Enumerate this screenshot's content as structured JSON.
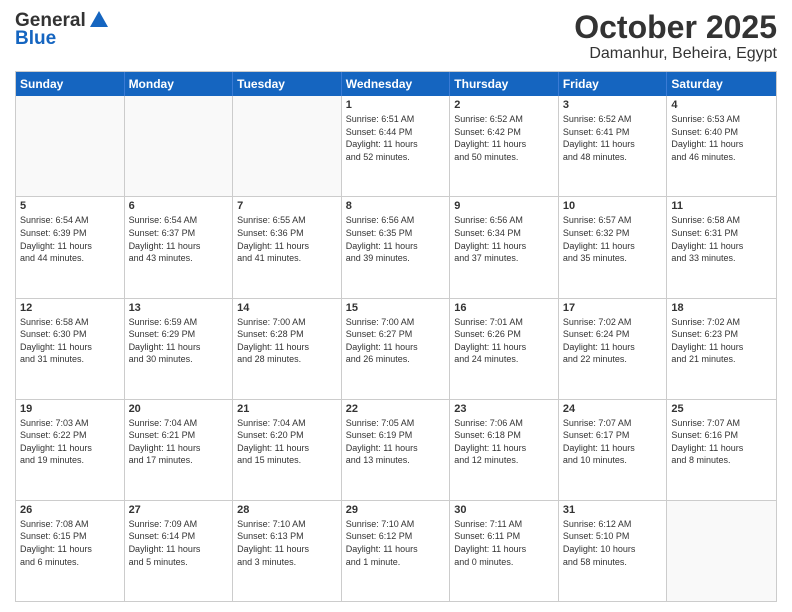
{
  "header": {
    "logo_general": "General",
    "logo_blue": "Blue",
    "month": "October 2025",
    "location": "Damanhur, Beheira, Egypt"
  },
  "days": [
    "Sunday",
    "Monday",
    "Tuesday",
    "Wednesday",
    "Thursday",
    "Friday",
    "Saturday"
  ],
  "weeks": [
    [
      {
        "date": "",
        "info": ""
      },
      {
        "date": "",
        "info": ""
      },
      {
        "date": "",
        "info": ""
      },
      {
        "date": "1",
        "info": "Sunrise: 6:51 AM\nSunset: 6:44 PM\nDaylight: 11 hours\nand 52 minutes."
      },
      {
        "date": "2",
        "info": "Sunrise: 6:52 AM\nSunset: 6:42 PM\nDaylight: 11 hours\nand 50 minutes."
      },
      {
        "date": "3",
        "info": "Sunrise: 6:52 AM\nSunset: 6:41 PM\nDaylight: 11 hours\nand 48 minutes."
      },
      {
        "date": "4",
        "info": "Sunrise: 6:53 AM\nSunset: 6:40 PM\nDaylight: 11 hours\nand 46 minutes."
      }
    ],
    [
      {
        "date": "5",
        "info": "Sunrise: 6:54 AM\nSunset: 6:39 PM\nDaylight: 11 hours\nand 44 minutes."
      },
      {
        "date": "6",
        "info": "Sunrise: 6:54 AM\nSunset: 6:37 PM\nDaylight: 11 hours\nand 43 minutes."
      },
      {
        "date": "7",
        "info": "Sunrise: 6:55 AM\nSunset: 6:36 PM\nDaylight: 11 hours\nand 41 minutes."
      },
      {
        "date": "8",
        "info": "Sunrise: 6:56 AM\nSunset: 6:35 PM\nDaylight: 11 hours\nand 39 minutes."
      },
      {
        "date": "9",
        "info": "Sunrise: 6:56 AM\nSunset: 6:34 PM\nDaylight: 11 hours\nand 37 minutes."
      },
      {
        "date": "10",
        "info": "Sunrise: 6:57 AM\nSunset: 6:32 PM\nDaylight: 11 hours\nand 35 minutes."
      },
      {
        "date": "11",
        "info": "Sunrise: 6:58 AM\nSunset: 6:31 PM\nDaylight: 11 hours\nand 33 minutes."
      }
    ],
    [
      {
        "date": "12",
        "info": "Sunrise: 6:58 AM\nSunset: 6:30 PM\nDaylight: 11 hours\nand 31 minutes."
      },
      {
        "date": "13",
        "info": "Sunrise: 6:59 AM\nSunset: 6:29 PM\nDaylight: 11 hours\nand 30 minutes."
      },
      {
        "date": "14",
        "info": "Sunrise: 7:00 AM\nSunset: 6:28 PM\nDaylight: 11 hours\nand 28 minutes."
      },
      {
        "date": "15",
        "info": "Sunrise: 7:00 AM\nSunset: 6:27 PM\nDaylight: 11 hours\nand 26 minutes."
      },
      {
        "date": "16",
        "info": "Sunrise: 7:01 AM\nSunset: 6:26 PM\nDaylight: 11 hours\nand 24 minutes."
      },
      {
        "date": "17",
        "info": "Sunrise: 7:02 AM\nSunset: 6:24 PM\nDaylight: 11 hours\nand 22 minutes."
      },
      {
        "date": "18",
        "info": "Sunrise: 7:02 AM\nSunset: 6:23 PM\nDaylight: 11 hours\nand 21 minutes."
      }
    ],
    [
      {
        "date": "19",
        "info": "Sunrise: 7:03 AM\nSunset: 6:22 PM\nDaylight: 11 hours\nand 19 minutes."
      },
      {
        "date": "20",
        "info": "Sunrise: 7:04 AM\nSunset: 6:21 PM\nDaylight: 11 hours\nand 17 minutes."
      },
      {
        "date": "21",
        "info": "Sunrise: 7:04 AM\nSunset: 6:20 PM\nDaylight: 11 hours\nand 15 minutes."
      },
      {
        "date": "22",
        "info": "Sunrise: 7:05 AM\nSunset: 6:19 PM\nDaylight: 11 hours\nand 13 minutes."
      },
      {
        "date": "23",
        "info": "Sunrise: 7:06 AM\nSunset: 6:18 PM\nDaylight: 11 hours\nand 12 minutes."
      },
      {
        "date": "24",
        "info": "Sunrise: 7:07 AM\nSunset: 6:17 PM\nDaylight: 11 hours\nand 10 minutes."
      },
      {
        "date": "25",
        "info": "Sunrise: 7:07 AM\nSunset: 6:16 PM\nDaylight: 11 hours\nand 8 minutes."
      }
    ],
    [
      {
        "date": "26",
        "info": "Sunrise: 7:08 AM\nSunset: 6:15 PM\nDaylight: 11 hours\nand 6 minutes."
      },
      {
        "date": "27",
        "info": "Sunrise: 7:09 AM\nSunset: 6:14 PM\nDaylight: 11 hours\nand 5 minutes."
      },
      {
        "date": "28",
        "info": "Sunrise: 7:10 AM\nSunset: 6:13 PM\nDaylight: 11 hours\nand 3 minutes."
      },
      {
        "date": "29",
        "info": "Sunrise: 7:10 AM\nSunset: 6:12 PM\nDaylight: 11 hours\nand 1 minute."
      },
      {
        "date": "30",
        "info": "Sunrise: 7:11 AM\nSunset: 6:11 PM\nDaylight: 11 hours\nand 0 minutes."
      },
      {
        "date": "31",
        "info": "Sunrise: 6:12 AM\nSunset: 5:10 PM\nDaylight: 10 hours\nand 58 minutes."
      },
      {
        "date": "",
        "info": ""
      }
    ]
  ]
}
